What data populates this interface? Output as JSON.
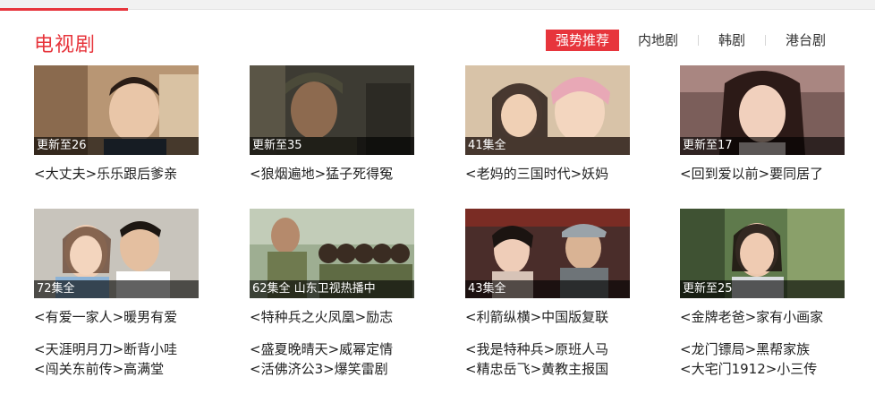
{
  "section": {
    "title": "电视剧",
    "tabs": [
      {
        "label": "强势推荐",
        "active": true
      },
      {
        "label": "内地剧",
        "active": false
      },
      {
        "label": "韩剧",
        "active": false
      },
      {
        "label": "港台剧",
        "active": false
      }
    ]
  },
  "cards": [
    {
      "caption": "更新至26",
      "title": "<大丈夫>乐乐跟后爹亲"
    },
    {
      "caption": "更新至35",
      "title": "<狼烟遍地>猛子死得冤"
    },
    {
      "caption": "41集全",
      "title": "<老妈的三国时代>妖妈"
    },
    {
      "caption": "更新至17",
      "title": "<回到爱以前>要同居了"
    },
    {
      "caption": "72集全",
      "title": "<有爱一家人>暖男有爱"
    },
    {
      "caption": "62集全 山东卫视热播中",
      "title": "<特种兵之火凤凰>励志"
    },
    {
      "caption": "43集全",
      "title": "<利箭纵横>中国版复联"
    },
    {
      "caption": "更新至25",
      "title": "<金牌老爸>家有小画家"
    }
  ],
  "links": [
    [
      "<天涯明月刀>断背小哇",
      "<闯关东前传>高满堂"
    ],
    [
      "<盛夏晚晴天>威幂定情",
      "<活佛济公3>爆笑雷剧"
    ],
    [
      "<我是特种兵>原班人马",
      "<精忠岳飞>黄教主报国"
    ],
    [
      "<龙门镖局>黑帮家族",
      "<大宅门1912>小三传"
    ]
  ],
  "colors": {
    "accent": "#e7353c"
  }
}
